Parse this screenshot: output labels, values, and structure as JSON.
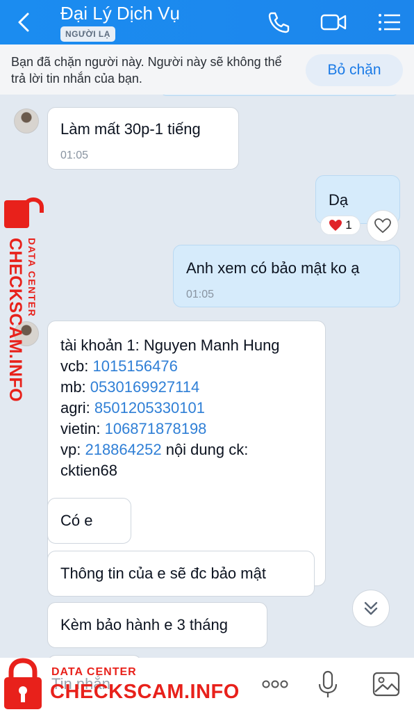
{
  "header": {
    "contact_name": "Đại Lý Dịch Vụ",
    "badge": "NGƯỜI LẠ",
    "icons": [
      "back-arrow-icon",
      "phone-icon",
      "video-call-icon",
      "menu-list-icon"
    ]
  },
  "block_notice": {
    "text": "Bạn đã chặn người này. Người này sẽ không thể trả lời tin nhắn của bạn.",
    "unblock_label": "Bỏ chặn"
  },
  "messages": [
    {
      "side": "in",
      "text": "Làm mất 30p-1 tiếng",
      "time": "01:05"
    },
    {
      "side": "out",
      "text": "Dạ",
      "reaction": {
        "emoji": "❤️",
        "count": "1"
      }
    },
    {
      "side": "out",
      "text": "Anh xem có bảo mật ko ạ",
      "time": "01:05"
    },
    {
      "side": "in",
      "lines": [
        {
          "prefix": "tài khoản 1: Nguyen Manh Hung",
          "number": "",
          "suffix": ""
        },
        {
          "prefix": "vcb: ",
          "number": "1015156476",
          "suffix": ""
        },
        {
          "prefix": "mb: ",
          "number": "0530169927114",
          "suffix": ""
        },
        {
          "prefix": "agri: ",
          "number": "8501205330101",
          "suffix": ""
        },
        {
          "prefix": "vietin: ",
          "number": "106871878198",
          "suffix": ""
        },
        {
          "prefix": "vp: ",
          "number": "218864252",
          "suffix": " nội dung ck:"
        },
        {
          "prefix": "cktien68",
          "number": "",
          "suffix": ""
        }
      ]
    },
    {
      "side": "in",
      "text": "Có e"
    },
    {
      "side": "in",
      "text": "Thông tin của e sẽ đc bảo mật"
    },
    {
      "side": "in",
      "text": "Kèm bảo hành e 3 tháng"
    }
  ],
  "composer": {
    "placeholder": "Tin nhắn",
    "icons": [
      "more-options-icon",
      "microphone-icon",
      "image-icon"
    ]
  },
  "watermark": {
    "small": "DATA CENTER",
    "big": "CHECKSCAM.INFO",
    "colors": {
      "brand": "#e8211b"
    }
  },
  "colors": {
    "header": "#1b8cf0",
    "outgoing_bubble": "#d6ebfb",
    "link_number": "#2f7fd6"
  }
}
